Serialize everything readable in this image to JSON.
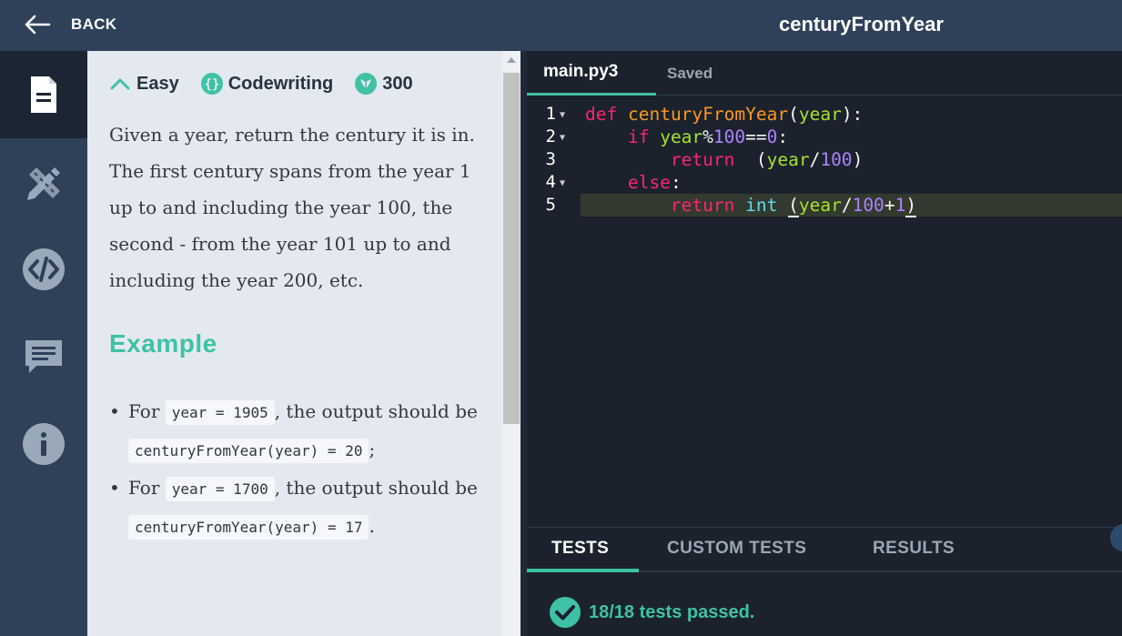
{
  "header": {
    "back_label": "BACK",
    "task_title": "centuryFromYear"
  },
  "sidebar": {
    "items": [
      {
        "name": "description",
        "icon": "document-icon",
        "active": true
      },
      {
        "name": "solutions",
        "icon": "pencil-ruler-icon",
        "active": false
      },
      {
        "name": "code",
        "icon": "code-icon",
        "active": false
      },
      {
        "name": "comments",
        "icon": "comment-icon",
        "active": false
      },
      {
        "name": "info",
        "icon": "info-icon",
        "active": false
      }
    ]
  },
  "task": {
    "difficulty": "Easy",
    "type": "Codewriting",
    "points": "300",
    "description": "Given a year, return the century it is in. The first century spans from the year 1 up to and including the year 100, the second - from the year 101 up to and including the year 200, etc.",
    "example_heading": "Example",
    "examples": [
      {
        "prefix": "For",
        "input": "year = 1905",
        "mid": ", the output should be",
        "output": "centuryFromYear(year) = 20",
        "end": ";"
      },
      {
        "prefix": "For",
        "input": "year = 1700",
        "mid": ", the output should be",
        "output": "centuryFromYear(year) = 17",
        "end": "."
      }
    ]
  },
  "editor": {
    "file_name": "main.py3",
    "status": "Saved",
    "lines": [
      "1",
      "2",
      "3",
      "4",
      "5"
    ]
  },
  "tests": {
    "tabs": [
      "TESTS",
      "CUSTOM TESTS",
      "RESULTS"
    ],
    "active_tab": "TESTS",
    "passed": "18/18",
    "passed_suffix": "tests passed."
  },
  "colors": {
    "accent": "#3fc1a5",
    "header_bg": "#2e4159",
    "editor_bg": "#1b222d",
    "panel_bg": "#e4e9f0"
  }
}
